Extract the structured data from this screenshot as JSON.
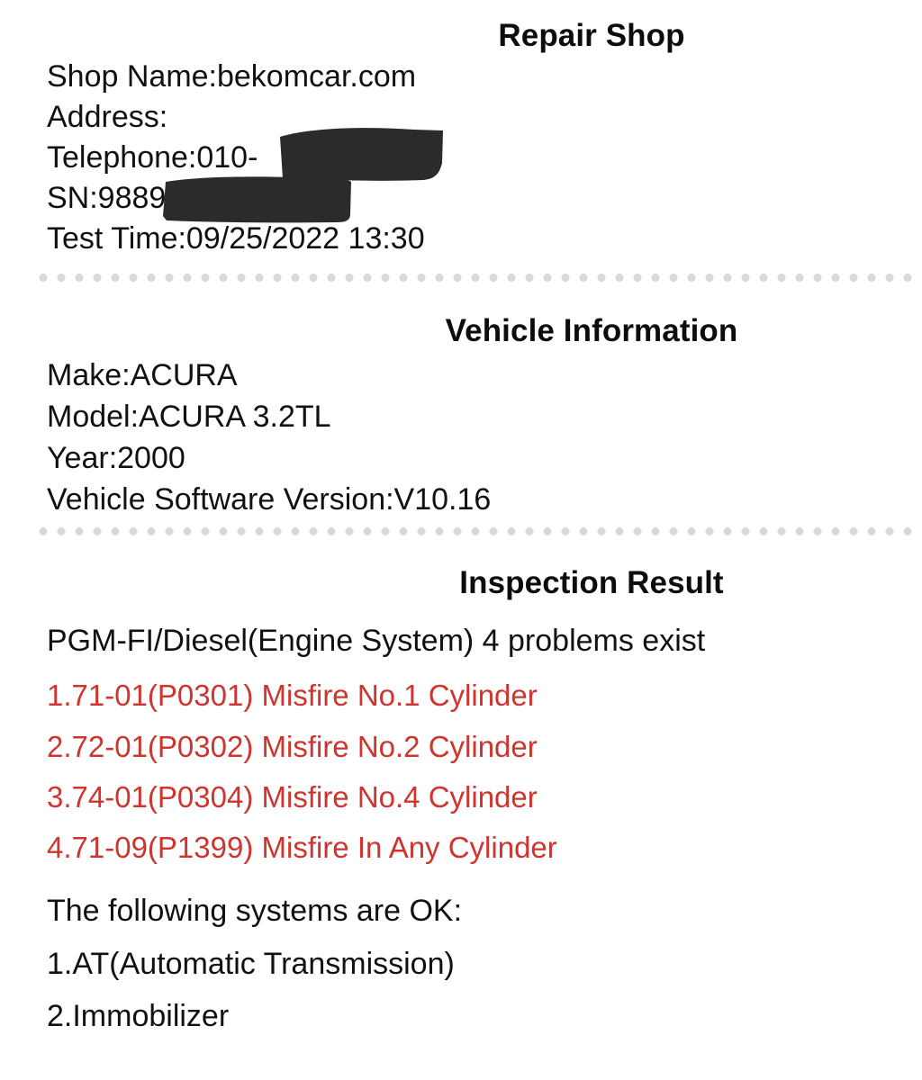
{
  "document": {
    "type": "vehicle-diagnostic-report",
    "background_color": "#ffffff",
    "text_color": "#111111",
    "fault_color": "#cf352e",
    "divider_color": "#d9d9d9",
    "redaction_color": "#2b2b2b"
  },
  "repair_shop": {
    "heading": "Repair Shop",
    "lines": [
      "Shop Name:bekomcar.com",
      "Address:",
      "Telephone:010-",
      "SN:9889",
      "Test Time:09/25/2022 13:30"
    ],
    "shop_name_label": "Shop Name:",
    "shop_name_value": "bekomcar.com",
    "address_label": "Address:",
    "address_value": "",
    "telephone_label": "Telephone:",
    "telephone_value": "010-",
    "sn_label": "SN:",
    "sn_value": "9889",
    "test_time_label": "Test Time:",
    "test_time_value": "09/25/2022 13:30"
  },
  "vehicle_information": {
    "heading": "Vehicle Information",
    "lines": [
      "Make:ACURA",
      "Model:ACURA 3.2TL",
      "Year:2000",
      "Vehicle Software Version:V10.16"
    ],
    "make": "ACURA",
    "model": "ACURA 3.2TL",
    "year": "2000",
    "software_version": "V10.16"
  },
  "inspection_result": {
    "heading": "Inspection Result",
    "system_summary": "PGM-FI/Diesel(Engine System) 4 problems exist",
    "problem_count": 4,
    "faults": [
      "1.71-01(P0301) Misfire No.1 Cylinder",
      "2.72-01(P0302) Misfire No.2 Cylinder",
      "3.74-01(P0304) Misfire No.4 Cylinder",
      "4.71-09(P1399) Misfire In Any Cylinder"
    ],
    "ok_heading": "The following systems are OK:",
    "ok_systems": [
      "1.AT(Automatic Transmission)",
      "2.Immobilizer"
    ]
  }
}
